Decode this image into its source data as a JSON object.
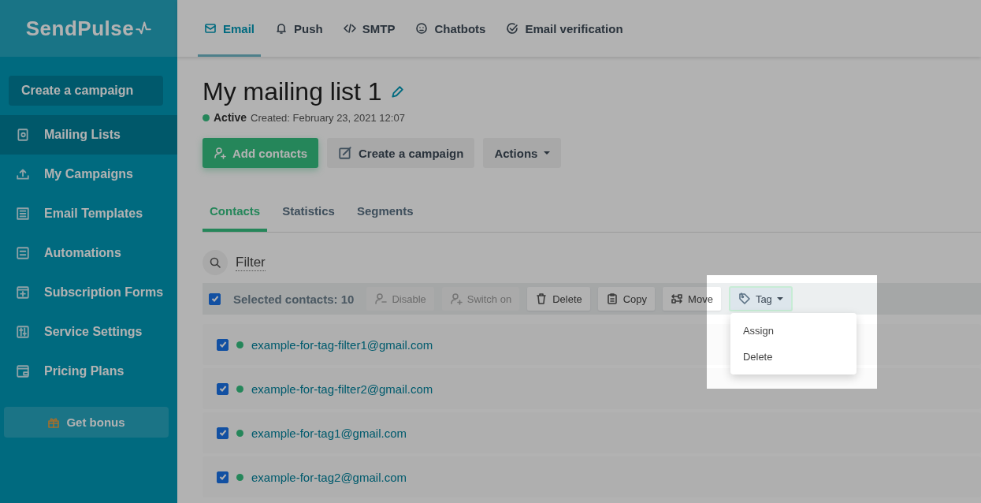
{
  "logo": {
    "text": "SendPulse"
  },
  "sidebar": {
    "create_button": {
      "label": "Create a campaign"
    },
    "items": [
      {
        "label": "Mailing Lists",
        "selected": true
      },
      {
        "label": "My Campaigns",
        "selected": false
      },
      {
        "label": "Email Templates",
        "selected": false
      },
      {
        "label": "Automations",
        "selected": false
      },
      {
        "label": "Subscription Forms",
        "selected": false
      },
      {
        "label": "Service Settings",
        "selected": false
      },
      {
        "label": "Pricing Plans",
        "selected": false
      }
    ],
    "bonus_button": {
      "label": "Get bonus"
    }
  },
  "top_nav": [
    {
      "label": "Email",
      "selected": true
    },
    {
      "label": "Push",
      "selected": false
    },
    {
      "label": "SMTP",
      "selected": false
    },
    {
      "label": "Chatbots",
      "selected": false
    },
    {
      "label": "Email verification",
      "selected": false
    }
  ],
  "list": {
    "title": "My mailing list 1",
    "status": "Active",
    "created": "Created: February 23, 2021 12:07"
  },
  "actions": [
    {
      "label": "Add contacts",
      "kind": "primary"
    },
    {
      "label": "Create a campaign",
      "kind": "secondary"
    },
    {
      "label": "Actions",
      "kind": "dropdown"
    }
  ],
  "tabs": [
    {
      "label": "Contacts",
      "selected": true
    },
    {
      "label": "Statistics",
      "selected": false
    },
    {
      "label": "Segments",
      "selected": false
    }
  ],
  "filter": {
    "label": "Filter"
  },
  "toolbar": {
    "checked": true,
    "selected_text": "Selected contacts: 10",
    "buttons": [
      {
        "label": "Disable",
        "kind": "disable",
        "disabled": true
      },
      {
        "label": "Switch on",
        "kind": "switch",
        "disabled": true
      },
      {
        "label": "Delete",
        "kind": "delete",
        "disabled": false
      },
      {
        "label": "Copy",
        "kind": "copy",
        "disabled": false
      },
      {
        "label": "Move",
        "kind": "move",
        "disabled": false
      }
    ],
    "tag": {
      "label": "Tag",
      "expanded": true,
      "menu": [
        "Assign",
        "Delete"
      ]
    }
  },
  "contacts": [
    {
      "email": "example-for-tag-filter1@gmail.com",
      "checked": true
    },
    {
      "email": "example-for-tag-filter2@gmail.com",
      "checked": true
    },
    {
      "email": "example-for-tag1@gmail.com",
      "checked": true
    },
    {
      "email": "example-for-tag2@gmail.com",
      "checked": true
    }
  ]
}
